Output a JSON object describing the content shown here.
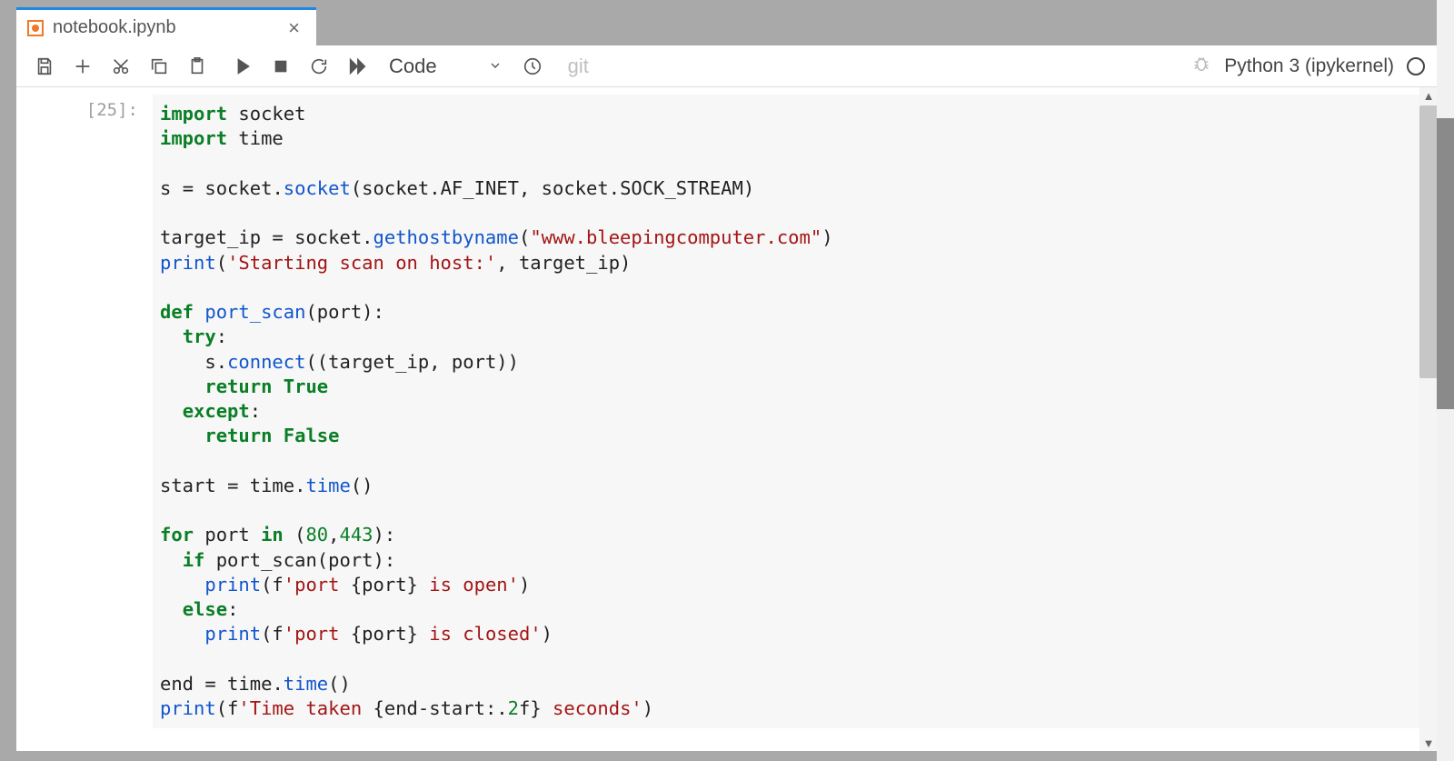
{
  "tab": {
    "title": "notebook.ipynb"
  },
  "toolbar": {
    "celltype": "Code",
    "git_label": "git",
    "kernel": "Python 3 (ipykernel)"
  },
  "cell": {
    "prompt": "[25]:",
    "code_tokens": [
      [
        [
          "kw",
          "import"
        ],
        [
          "p",
          " socket"
        ]
      ],
      [
        [
          "kw",
          "import"
        ],
        [
          "p",
          " time"
        ]
      ],
      [],
      [
        [
          "p",
          "s "
        ],
        [
          "op",
          "="
        ],
        [
          "p",
          " socket"
        ],
        [
          "op",
          "."
        ],
        [
          "fn",
          "socket"
        ],
        [
          "p",
          "(socket"
        ],
        [
          "op",
          "."
        ],
        [
          "p",
          "AF_INET"
        ],
        [
          "op",
          ","
        ],
        [
          "p",
          " socket"
        ],
        [
          "op",
          "."
        ],
        [
          "p",
          "SOCK_STREAM)"
        ]
      ],
      [],
      [
        [
          "p",
          "target_ip "
        ],
        [
          "op",
          "="
        ],
        [
          "p",
          " socket"
        ],
        [
          "op",
          "."
        ],
        [
          "fn",
          "gethostbyname"
        ],
        [
          "p",
          "("
        ],
        [
          "str",
          "\"www.bleepingcomputer.com\""
        ],
        [
          "p",
          ")"
        ]
      ],
      [
        [
          "fn",
          "print"
        ],
        [
          "p",
          "("
        ],
        [
          "str",
          "'Starting scan on host:'"
        ],
        [
          "op",
          ","
        ],
        [
          "p",
          " target_ip)"
        ]
      ],
      [],
      [
        [
          "kw",
          "def"
        ],
        [
          "p",
          " "
        ],
        [
          "fn",
          "port_scan"
        ],
        [
          "p",
          "(port):"
        ]
      ],
      [
        [
          "p",
          "  "
        ],
        [
          "kw",
          "try"
        ],
        [
          "p",
          ":"
        ]
      ],
      [
        [
          "p",
          "    s"
        ],
        [
          "op",
          "."
        ],
        [
          "fn",
          "connect"
        ],
        [
          "p",
          "((target_ip"
        ],
        [
          "op",
          ","
        ],
        [
          "p",
          " port))"
        ]
      ],
      [
        [
          "p",
          "    "
        ],
        [
          "kw",
          "return"
        ],
        [
          "p",
          " "
        ],
        [
          "bool",
          "True"
        ]
      ],
      [
        [
          "p",
          "  "
        ],
        [
          "kw",
          "except"
        ],
        [
          "p",
          ":"
        ]
      ],
      [
        [
          "p",
          "    "
        ],
        [
          "kw",
          "return"
        ],
        [
          "p",
          " "
        ],
        [
          "bool",
          "False"
        ]
      ],
      [],
      [
        [
          "p",
          "start "
        ],
        [
          "op",
          "="
        ],
        [
          "p",
          " time"
        ],
        [
          "op",
          "."
        ],
        [
          "fn",
          "time"
        ],
        [
          "p",
          "()"
        ]
      ],
      [],
      [
        [
          "kw",
          "for"
        ],
        [
          "p",
          " port "
        ],
        [
          "kw",
          "in"
        ],
        [
          "p",
          " ("
        ],
        [
          "num",
          "80"
        ],
        [
          "op",
          ","
        ],
        [
          "num",
          "443"
        ],
        [
          "p",
          "):"
        ]
      ],
      [
        [
          "p",
          "  "
        ],
        [
          "kw",
          "if"
        ],
        [
          "p",
          " port_scan(port):"
        ]
      ],
      [
        [
          "p",
          "    "
        ],
        [
          "fn",
          "print"
        ],
        [
          "p",
          "(f"
        ],
        [
          "str",
          "'port "
        ],
        [
          "p",
          "{port}"
        ],
        [
          "str",
          " is open'"
        ],
        [
          "p",
          ")"
        ]
      ],
      [
        [
          "p",
          "  "
        ],
        [
          "kw",
          "else"
        ],
        [
          "p",
          ":"
        ]
      ],
      [
        [
          "p",
          "    "
        ],
        [
          "fn",
          "print"
        ],
        [
          "p",
          "(f"
        ],
        [
          "str",
          "'port "
        ],
        [
          "p",
          "{port}"
        ],
        [
          "str",
          " is closed'"
        ],
        [
          "p",
          ")"
        ]
      ],
      [],
      [
        [
          "p",
          "end "
        ],
        [
          "op",
          "="
        ],
        [
          "p",
          " time"
        ],
        [
          "op",
          "."
        ],
        [
          "fn",
          "time"
        ],
        [
          "p",
          "()"
        ]
      ],
      [
        [
          "fn",
          "print"
        ],
        [
          "p",
          "(f"
        ],
        [
          "str",
          "'Time taken "
        ],
        [
          "p",
          "{end"
        ],
        [
          "op",
          "-"
        ],
        [
          "p",
          "start"
        ],
        [
          "op",
          ":."
        ],
        [
          "num",
          "2"
        ],
        [
          "p",
          "f}"
        ],
        [
          "str",
          " seconds'"
        ],
        [
          "p",
          ")"
        ]
      ]
    ]
  }
}
